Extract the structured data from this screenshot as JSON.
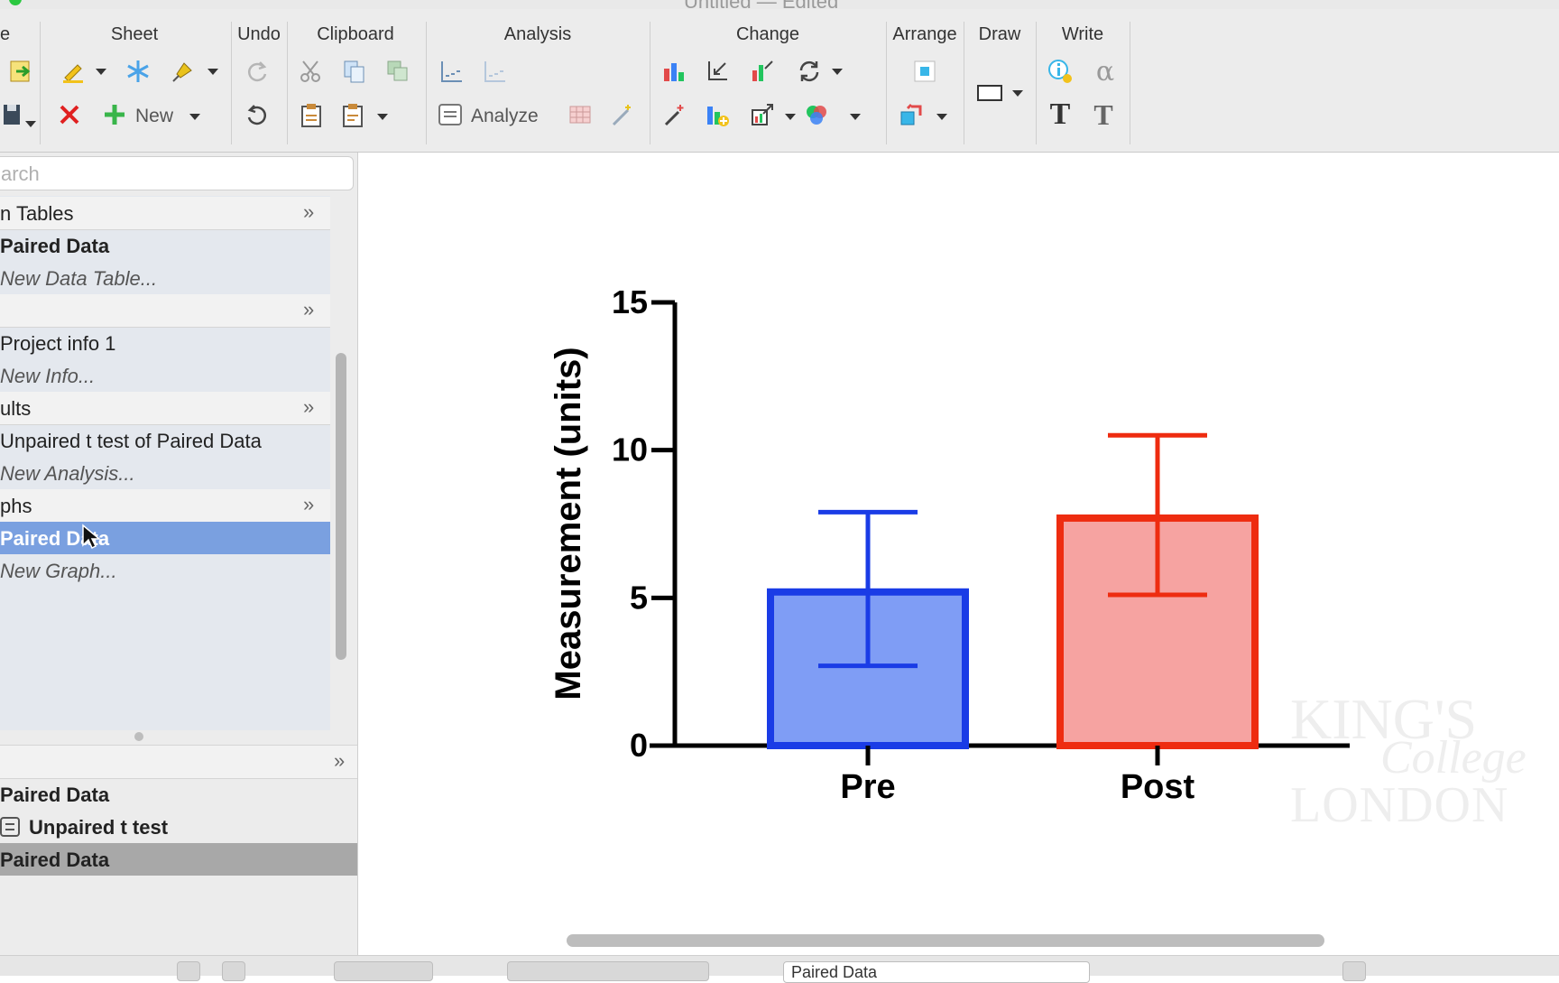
{
  "window": {
    "title": "Untitled — Edited"
  },
  "toolbar": {
    "groups": {
      "file": "e",
      "sheet": "Sheet",
      "undo": "Undo",
      "clipboard": "Clipboard",
      "analysis": "Analysis",
      "change": "Change",
      "arrange": "Arrange",
      "draw": "Draw",
      "write": "Write"
    },
    "new_label": "New",
    "analyze_label": "Analyze",
    "alpha_glyph": "α",
    "text_glyph": "T"
  },
  "sidebar": {
    "search_placeholder": "arch",
    "items": [
      {
        "label": "n Tables",
        "kind": "header"
      },
      {
        "label": "Paired Data",
        "kind": "bold"
      },
      {
        "label": "New Data Table...",
        "kind": "new"
      },
      {
        "label": "",
        "kind": "header"
      },
      {
        "label": "Project info 1",
        "kind": "normal"
      },
      {
        "label": "New Info...",
        "kind": "new"
      },
      {
        "label": "ults",
        "kind": "header"
      },
      {
        "label": "Unpaired t test of Paired Data",
        "kind": "normal"
      },
      {
        "label": "New Analysis...",
        "kind": "new"
      },
      {
        "label": "phs",
        "kind": "header"
      },
      {
        "label": "Paired Data",
        "kind": "selected"
      },
      {
        "label": "New Graph...",
        "kind": "new"
      }
    ],
    "family": [
      {
        "label": "Paired Data"
      },
      {
        "label": "Unpaired t test"
      },
      {
        "label": "Paired Data"
      }
    ],
    "chevron": "»"
  },
  "chart_data": {
    "type": "bar",
    "categories": [
      "Pre",
      "Post"
    ],
    "values": [
      5.2,
      7.7
    ],
    "error_low": [
      2.7,
      5.1
    ],
    "error_high": [
      7.9,
      10.5
    ],
    "colors": {
      "fill": [
        "#7f9df5",
        "#f6a3a1"
      ],
      "stroke": [
        "#1a3ce6",
        "#ee2c10"
      ]
    },
    "ylabel": "Measurement (units)",
    "xlabel": "",
    "ylim": [
      0,
      15
    ],
    "yticks": [
      0,
      5,
      10,
      15
    ],
    "grid": false
  },
  "watermark": {
    "line1": "KING'S",
    "line2": "College",
    "line3": "LONDON"
  },
  "statusbar": {
    "sheet_field": "Paired Data"
  }
}
